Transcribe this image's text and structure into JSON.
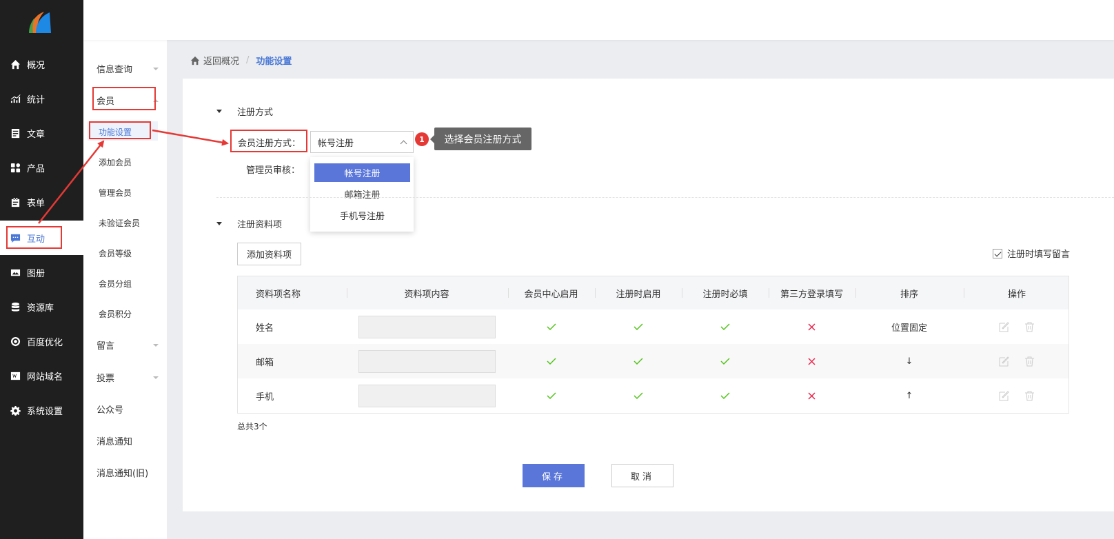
{
  "sidebar": {
    "items": [
      {
        "label": "概况",
        "icon": "home-icon"
      },
      {
        "label": "统计",
        "icon": "stats-icon"
      },
      {
        "label": "文章",
        "icon": "article-icon"
      },
      {
        "label": "产品",
        "icon": "product-icon"
      },
      {
        "label": "表单",
        "icon": "form-icon"
      },
      {
        "label": "互动",
        "icon": "chat-icon"
      },
      {
        "label": "图册",
        "icon": "album-icon"
      },
      {
        "label": "资源库",
        "icon": "database-icon"
      },
      {
        "label": "百度优化",
        "icon": "seo-icon"
      },
      {
        "label": "网站域名",
        "icon": "domain-icon"
      },
      {
        "label": "系统设置",
        "icon": "gear-icon"
      }
    ],
    "active_index": 5
  },
  "subnav": {
    "info_query": "信息查询",
    "member": "会员",
    "member_children": [
      "功能设置",
      "添加会员",
      "管理会员",
      "未验证会员",
      "会员等级",
      "会员分组",
      "会员积分"
    ],
    "message": "留言",
    "vote": "投票",
    "wechat": "公众号",
    "notify": "消息通知",
    "notify_old": "消息通知(旧)"
  },
  "breadcrumb": {
    "back": "返回概况",
    "separator": "/",
    "current": "功能设置"
  },
  "registration": {
    "section_title": "注册方式",
    "method_label": "会员注册方式：",
    "method_value": "帐号注册",
    "admin_review_label": "管理员审核：",
    "options": [
      "帐号注册",
      "邮箱注册",
      "手机号注册"
    ],
    "selected_option": 0
  },
  "annotation": {
    "badge": "1",
    "tooltip": "选择会员注册方式"
  },
  "fields": {
    "section_title": "注册资料项",
    "add_button": "添加资料项",
    "checkbox_label": "注册时填写留言",
    "columns": [
      "资料项名称",
      "资料项内容",
      "会员中心启用",
      "注册时启用",
      "注册时必填",
      "第三方登录填写",
      "排序",
      "操作"
    ],
    "rows": [
      {
        "name": "姓名",
        "center": true,
        "reg_enable": true,
        "reg_required": true,
        "third_party": false,
        "sort": "位置固定"
      },
      {
        "name": "邮箱",
        "center": true,
        "reg_enable": true,
        "reg_required": true,
        "third_party": false,
        "sort": "↓"
      },
      {
        "name": "手机",
        "center": true,
        "reg_enable": true,
        "reg_required": true,
        "third_party": false,
        "sort": "↑"
      }
    ],
    "total": "总共3个"
  },
  "actions": {
    "save": "保存",
    "cancel": "取消"
  },
  "colors": {
    "accent": "#5a76d9",
    "check": "#52c41a",
    "cross": "#e8264c",
    "annotation": "#e53935"
  }
}
